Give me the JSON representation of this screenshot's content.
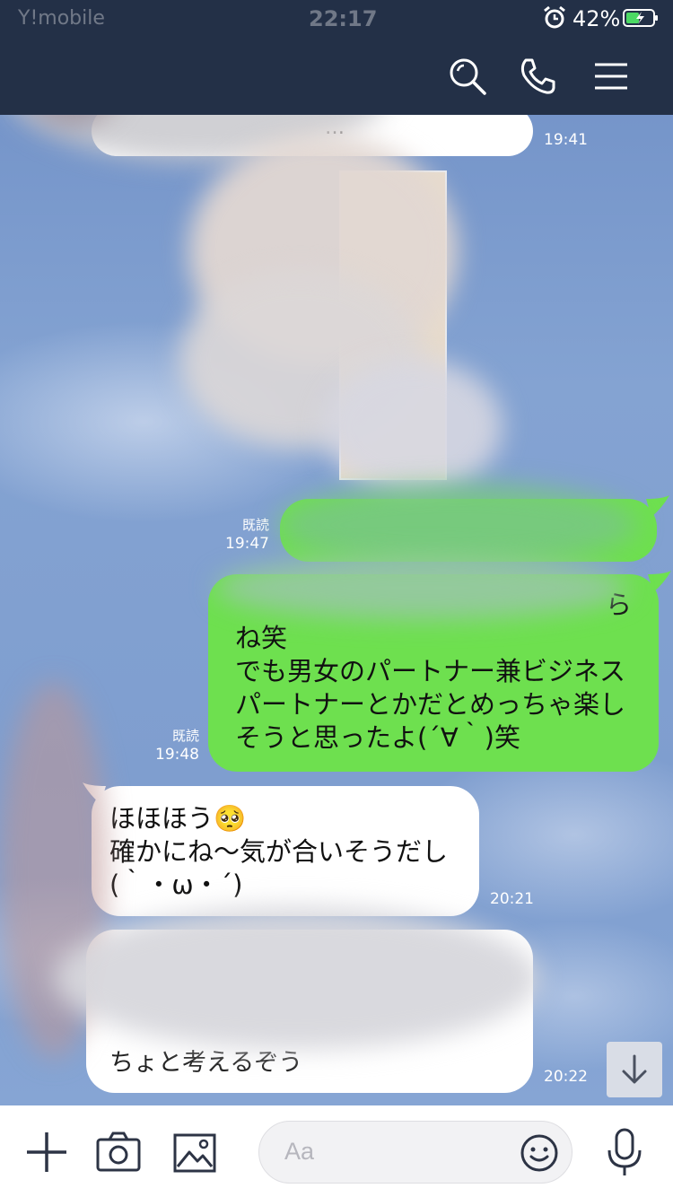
{
  "status_bar": {
    "carrier": "Y!mobile",
    "time": "22:17",
    "battery": "42%"
  },
  "header": {
    "icons": [
      "search-icon",
      "phone-icon",
      "menu-icon"
    ]
  },
  "messages": [
    {
      "direction": "in",
      "time": "19:41",
      "text": [
        "…"
      ]
    },
    {
      "direction": "out",
      "read": "既読",
      "time": "19:47",
      "text": [
        ""
      ]
    },
    {
      "direction": "out",
      "read": "既読",
      "time": "19:48",
      "text": [
        "ら",
        "ね笑",
        "でも男女のパートナー兼ビジネス",
        "パートナーとかだとめっちゃ楽し",
        "そうと思ったよ(´∀｀)笑"
      ]
    },
    {
      "direction": "in",
      "time": "20:21",
      "text": [
        "ほほほう🥺",
        "確かにね〜気が合いそうだし",
        "(｀・ω・´)"
      ]
    },
    {
      "direction": "in",
      "time": "20:22",
      "text": [
        "ちょと考えるぞう"
      ]
    }
  ],
  "composer": {
    "placeholder": "Aa",
    "icons": [
      "plus-icon",
      "camera-icon",
      "image-icon",
      "emoji-icon",
      "mic-icon"
    ]
  },
  "colors": {
    "header_bg": "#233047",
    "outgoing_bubble": "#6ee04f",
    "incoming_bubble": "#ffffff"
  }
}
